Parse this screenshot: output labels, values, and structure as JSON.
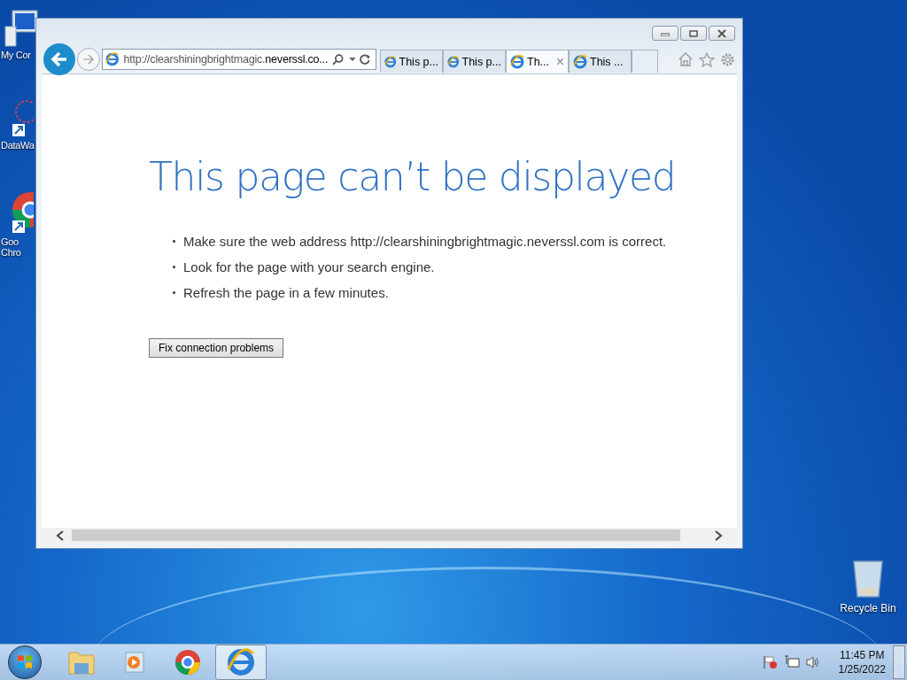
{
  "desktop_icons": [
    {
      "kind": "computer",
      "label": "My Cor"
    },
    {
      "kind": "shortcut-net",
      "label": "DataWa"
    },
    {
      "kind": "chrome",
      "label": "Goo Chro"
    },
    {
      "kind": "recycle",
      "label": "Recycle Bin"
    }
  ],
  "browser": {
    "address": {
      "prefix": "http://clearshiningbrightmagic.",
      "domain": "neverssl.co..."
    },
    "tabs": [
      {
        "label": "This p...",
        "selected": false
      },
      {
        "label": "This p...",
        "selected": false
      },
      {
        "label": "Th...",
        "selected": true
      },
      {
        "label": "This ...",
        "selected": false
      }
    ],
    "close_glyph": "×",
    "page": {
      "heading": "This page can’t be displayed",
      "bullets": [
        "Make sure the web address http://clearshiningbrightmagic.neverssl.com is correct.",
        "Look for the page with your search engine.",
        "Refresh the page in a few minutes."
      ],
      "button": "Fix connection problems"
    }
  },
  "taskbar": {
    "apps": [
      {
        "kind": "folder",
        "selected": false
      },
      {
        "kind": "media",
        "selected": false
      },
      {
        "kind": "chrome",
        "selected": false
      },
      {
        "kind": "ie",
        "selected": true
      }
    ],
    "time": "11:45 PM",
    "date": "1/25/2022"
  }
}
